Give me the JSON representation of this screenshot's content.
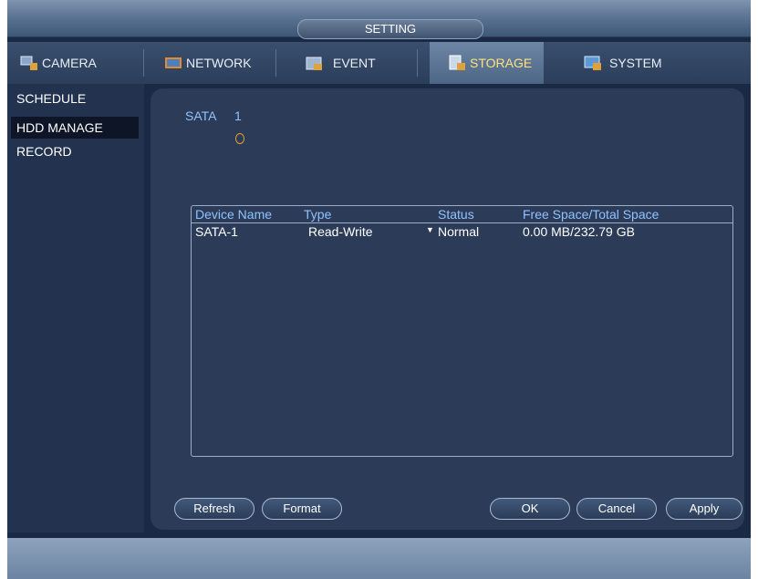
{
  "window": {
    "title": "SETTING"
  },
  "tabs": [
    {
      "label": "CAMERA",
      "icon": "camera-icon",
      "active": false
    },
    {
      "label": "NETWORK",
      "icon": "network-icon",
      "active": false
    },
    {
      "label": "EVENT",
      "icon": "event-icon",
      "active": false
    },
    {
      "label": "STORAGE",
      "icon": "storage-icon",
      "active": true
    },
    {
      "label": "SYSTEM",
      "icon": "system-icon",
      "active": false
    }
  ],
  "sidebar": {
    "items": [
      {
        "label": "SCHEDULE",
        "active": false
      },
      {
        "label": "HDD MANAGE",
        "active": true
      },
      {
        "label": "RECORD",
        "active": false
      }
    ]
  },
  "disk_group": {
    "label": "SATA",
    "number": "1"
  },
  "table": {
    "headers": [
      "Device Name",
      "Type",
      "Status",
      "Free Space/Total Space"
    ],
    "rows": [
      {
        "device": "SATA-1",
        "type": "Read-Write",
        "status": "Normal",
        "space": "0.00 MB/232.79 GB"
      }
    ]
  },
  "buttons": {
    "refresh": "Refresh",
    "format": "Format",
    "ok": "OK",
    "cancel": "Cancel",
    "apply": "Apply"
  },
  "colors": {
    "background": "#1b2a44",
    "panel": "#2c3b57",
    "header_text": "#8fc3ff",
    "active_tab_text": "#ffe37a"
  }
}
